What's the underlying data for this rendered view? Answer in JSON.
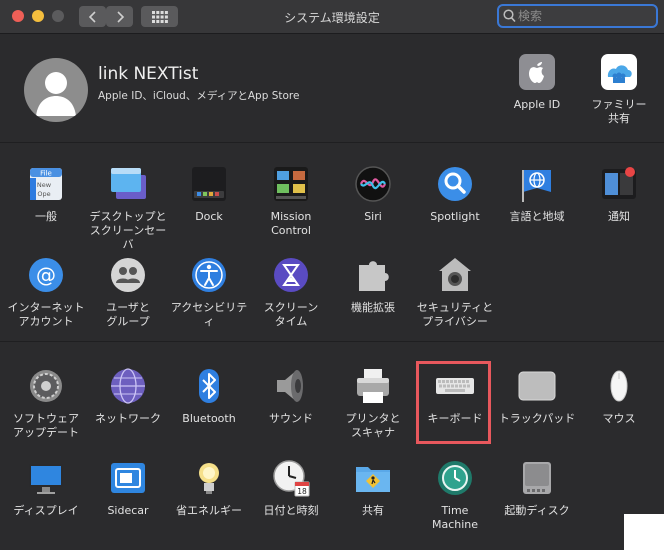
{
  "window": {
    "title": "システム環境設定"
  },
  "search": {
    "placeholder": "検索",
    "value": ""
  },
  "user": {
    "name": "link NEXTist",
    "subtitle": "Apple ID、iCloud、メディアとApp Store"
  },
  "top_right": [
    {
      "label": "Apple ID",
      "icon": "apple-id-icon"
    },
    {
      "label": "ファミリー\n共有",
      "icon": "family-sharing-icon"
    }
  ],
  "section1": [
    {
      "label": "一般",
      "icon": "general-icon"
    },
    {
      "label": "デスクトップと\nスクリーンセーバ",
      "icon": "desktop-screensaver-icon"
    },
    {
      "label": "Dock",
      "icon": "dock-icon"
    },
    {
      "label": "Mission\nControl",
      "icon": "mission-control-icon"
    },
    {
      "label": "Siri",
      "icon": "siri-icon"
    },
    {
      "label": "Spotlight",
      "icon": "spotlight-icon"
    },
    {
      "label": "言語と地域",
      "icon": "language-region-icon"
    },
    {
      "label": "通知",
      "icon": "notifications-icon"
    },
    {
      "label": "インターネット\nアカウント",
      "icon": "internet-accounts-icon"
    },
    {
      "label": "ユーザと\nグループ",
      "icon": "users-groups-icon"
    },
    {
      "label": "アクセシビリティ",
      "icon": "accessibility-icon"
    },
    {
      "label": "スクリーン\nタイム",
      "icon": "screen-time-icon"
    },
    {
      "label": "機能拡張",
      "icon": "extensions-icon"
    },
    {
      "label": "セキュリティと\nプライバシー",
      "icon": "security-privacy-icon"
    }
  ],
  "section2": [
    {
      "label": "ソフトウェア\nアップデート",
      "icon": "software-update-icon"
    },
    {
      "label": "ネットワーク",
      "icon": "network-icon"
    },
    {
      "label": "Bluetooth",
      "icon": "bluetooth-icon"
    },
    {
      "label": "サウンド",
      "icon": "sound-icon"
    },
    {
      "label": "プリンタと\nスキャナ",
      "icon": "printers-scanners-icon"
    },
    {
      "label": "キーボード",
      "icon": "keyboard-icon"
    },
    {
      "label": "トラックパッド",
      "icon": "trackpad-icon"
    },
    {
      "label": "マウス",
      "icon": "mouse-icon"
    },
    {
      "label": "ディスプレイ",
      "icon": "displays-icon"
    },
    {
      "label": "Sidecar",
      "icon": "sidecar-icon"
    },
    {
      "label": "省エネルギー",
      "icon": "energy-saver-icon"
    },
    {
      "label": "日付と時刻",
      "icon": "date-time-icon"
    },
    {
      "label": "共有",
      "icon": "sharing-icon"
    },
    {
      "label": "Time\nMachine",
      "icon": "time-machine-icon"
    },
    {
      "label": "起動ディスク",
      "icon": "startup-disk-icon"
    }
  ],
  "colors": {
    "highlight": "#e8585d",
    "accent": "#3a78d6"
  }
}
